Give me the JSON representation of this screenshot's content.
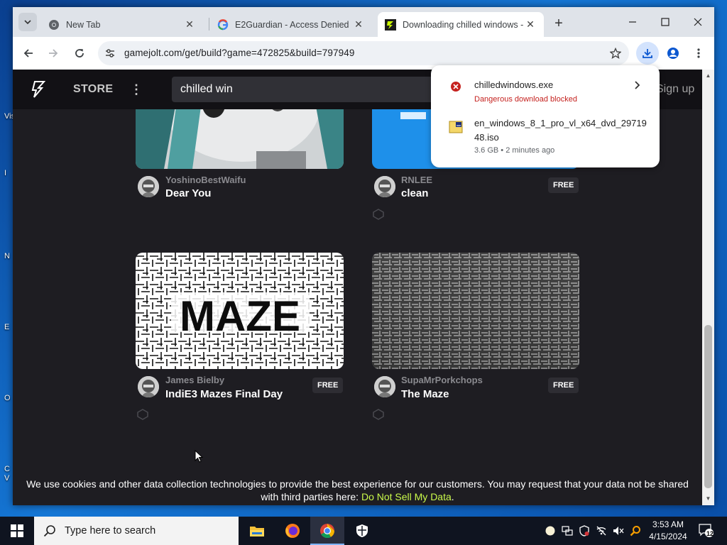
{
  "colors": {
    "accent_lime": "#c9f94a",
    "danger_red": "#c5221f",
    "page_bg": "#1e1d22"
  },
  "desktop": {
    "labels": [
      "Vis",
      "N",
      "E",
      "O",
      "C",
      "V"
    ]
  },
  "browser": {
    "tabs": [
      {
        "title": "New Tab",
        "icon": "chrome-icon",
        "active": false
      },
      {
        "title": "E2Guardian - Access Denied",
        "icon": "google-icon",
        "active": false
      },
      {
        "title": "Downloading chilled windows -",
        "icon": "gamejolt-icon",
        "active": true
      }
    ],
    "url": "gamejolt.com/get/build?game=472825&build=797949"
  },
  "gamejolt": {
    "store_label": "STORE",
    "search_value": "chilled win",
    "signup_label": "Sign up",
    "games": [
      {
        "author": "YoshinoBestWaifu",
        "title": "Dear You",
        "free": ""
      },
      {
        "author": "RNLEE",
        "title": "clean",
        "free": "FREE"
      },
      {
        "author": "James Bielby",
        "title": "IndiE3 Mazes Final Day",
        "free": "FREE",
        "image_text": "MAZE"
      },
      {
        "author": "SupaMrPorkchops",
        "title": "The Maze",
        "free": "FREE"
      }
    ],
    "cookie_text": "We use cookies and other data collection technologies to provide the best experience for our customers. You may request that your data not be shared with third parties here:",
    "cookie_link": "Do Not Sell My Data",
    "cookie_end": "."
  },
  "downloads": [
    {
      "name": "chilledwindows.exe",
      "status": "Dangerous download blocked",
      "icon": "blocked-icon"
    },
    {
      "name": "en_windows_8_1_pro_vl_x64_dvd_2971948.iso",
      "status": "3.6 GB • 2 minutes ago",
      "icon": "iso-file-icon"
    }
  ],
  "taskbar": {
    "search_placeholder": "Type here to search",
    "time": "3:53 AM",
    "date": "4/15/2024",
    "notification_count": "12"
  }
}
